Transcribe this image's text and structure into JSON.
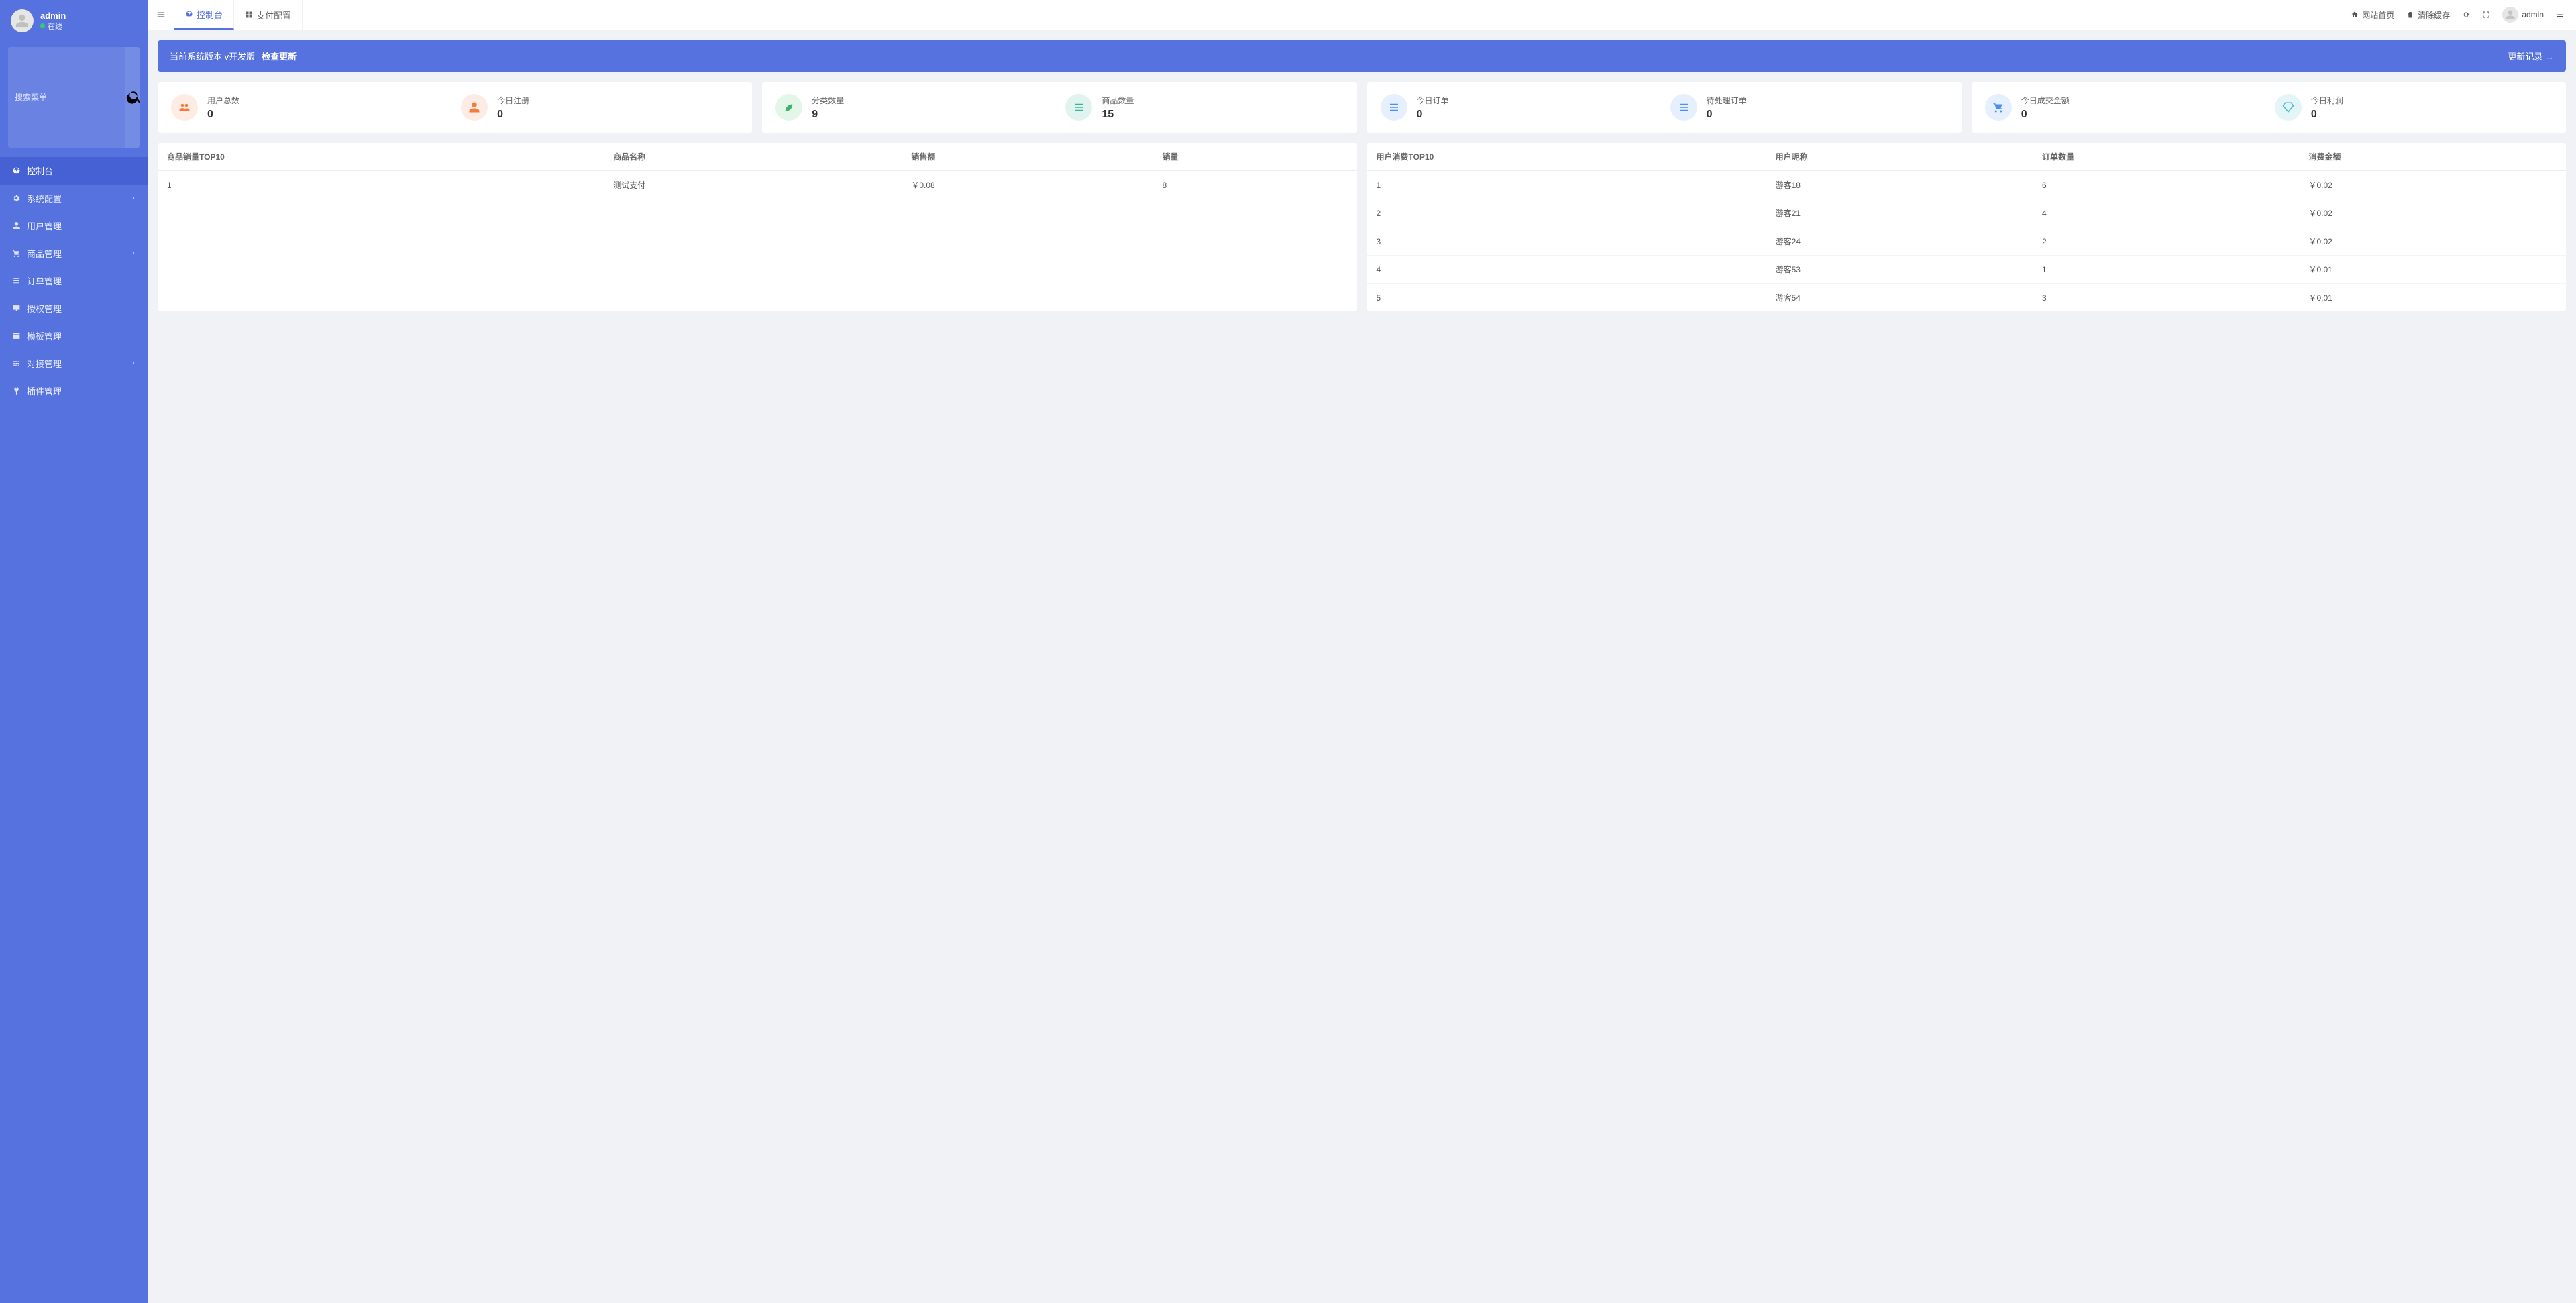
{
  "sidebar": {
    "user_name": "admin",
    "user_status": "在线",
    "search_placeholder": "搜索菜单",
    "menu": [
      {
        "key": "dashboard",
        "label": "控制台",
        "icon": "dashboard",
        "active": true
      },
      {
        "key": "system",
        "label": "系统配置",
        "icon": "gear",
        "expandable": true
      },
      {
        "key": "users",
        "label": "用户管理",
        "icon": "user"
      },
      {
        "key": "products",
        "label": "商品管理",
        "icon": "cart",
        "expandable": true
      },
      {
        "key": "orders",
        "label": "订单管理",
        "icon": "list"
      },
      {
        "key": "auth",
        "label": "授权管理",
        "icon": "desktop"
      },
      {
        "key": "templates",
        "label": "模板管理",
        "icon": "window"
      },
      {
        "key": "dock",
        "label": "对接管理",
        "icon": "sliders",
        "expandable": true
      },
      {
        "key": "plugins",
        "label": "插件管理",
        "icon": "plug"
      }
    ]
  },
  "header": {
    "tabs": [
      {
        "key": "dashboard",
        "label": "控制台",
        "icon": "dashboard",
        "active": true
      },
      {
        "key": "payconfig",
        "label": "支付配置",
        "icon": "grid"
      }
    ],
    "right": {
      "site_home": "网站首页",
      "clear_cache": "清除缓存",
      "admin_name": "admin"
    }
  },
  "banner": {
    "version_text": "当前系统版本 v开发版",
    "check_label": "检查更新",
    "history_label": "更新记录 →"
  },
  "stats": {
    "user_total": {
      "label": "用户总数",
      "value": "0"
    },
    "today_register": {
      "label": "今日注册",
      "value": "0"
    },
    "category_count": {
      "label": "分类数量",
      "value": "9"
    },
    "product_count": {
      "label": "商品数量",
      "value": "15"
    },
    "today_orders": {
      "label": "今日订单",
      "value": "0"
    },
    "pending_orders": {
      "label": "待处理订单",
      "value": "0"
    },
    "today_turnover": {
      "label": "今日成交金额",
      "value": "0"
    },
    "today_profit": {
      "label": "今日利润",
      "value": "0"
    }
  },
  "sales_table": {
    "title": "商品销量TOP10",
    "headers": [
      "商品销量TOP10",
      "商品名称",
      "销售额",
      "销量"
    ],
    "rows": [
      {
        "rank": "1",
        "name": "测试支付",
        "amount": "￥0.08",
        "qty": "8"
      }
    ]
  },
  "consume_table": {
    "title": "用户消费TOP10",
    "headers": [
      "用户消费TOP10",
      "用户昵称",
      "订单数量",
      "消费金额"
    ],
    "rows": [
      {
        "rank": "1",
        "nick": "游客18",
        "orders": "6",
        "amount": "￥0.02"
      },
      {
        "rank": "2",
        "nick": "游客21",
        "orders": "4",
        "amount": "￥0.02"
      },
      {
        "rank": "3",
        "nick": "游客24",
        "orders": "2",
        "amount": "￥0.02"
      },
      {
        "rank": "4",
        "nick": "游客53",
        "orders": "1",
        "amount": "￥0.01"
      },
      {
        "rank": "5",
        "nick": "游客54",
        "orders": "3",
        "amount": "￥0.01"
      }
    ]
  }
}
